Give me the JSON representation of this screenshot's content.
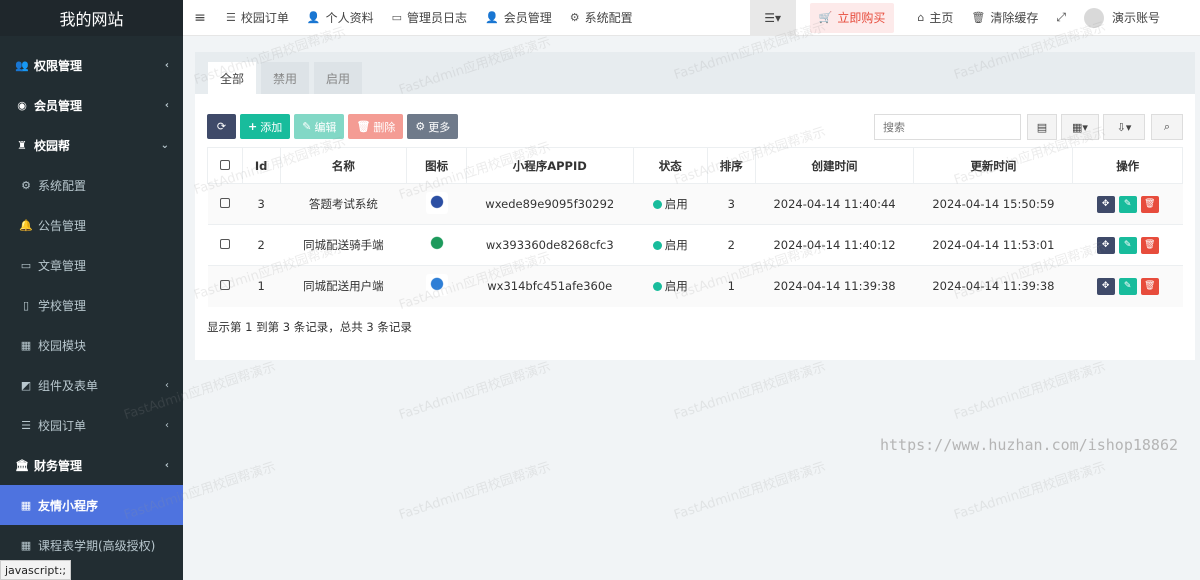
{
  "logo": "我的网站",
  "sidebar": {
    "items": [
      {
        "label": "权限管理",
        "icon": "users-icon",
        "top": true,
        "arrow": "‹"
      },
      {
        "label": "会员管理",
        "icon": "user-circle-icon",
        "top": true,
        "arrow": "‹"
      },
      {
        "label": "校园帮",
        "icon": "sitemap-icon",
        "top": true,
        "arrow": "⌄"
      },
      {
        "label": "系统配置",
        "icon": "cogs-icon",
        "top": false,
        "arrow": ""
      },
      {
        "label": "公告管理",
        "icon": "bell-icon",
        "top": false,
        "arrow": ""
      },
      {
        "label": "文章管理",
        "icon": "newspaper-icon",
        "top": false,
        "arrow": ""
      },
      {
        "label": "学校管理",
        "icon": "building-icon",
        "top": false,
        "arrow": ""
      },
      {
        "label": "校园模块",
        "icon": "grid-icon",
        "top": false,
        "arrow": ""
      },
      {
        "label": "组件及表单",
        "icon": "cubes-icon",
        "top": false,
        "arrow": "‹"
      },
      {
        "label": "校园订单",
        "icon": "list-icon",
        "top": false,
        "arrow": "‹"
      },
      {
        "label": "财务管理",
        "icon": "bank-icon",
        "top": true,
        "arrow": "‹"
      },
      {
        "label": "友情小程序",
        "icon": "grid-large-icon",
        "top": false,
        "arrow": "",
        "active": true
      },
      {
        "label": "课程表学期(高级授权)",
        "icon": "calendar-icon",
        "top": false,
        "arrow": ""
      }
    ]
  },
  "header": {
    "nav": [
      {
        "label": "校园订单",
        "icon": "list-icon"
      },
      {
        "label": "个人资料",
        "icon": "user-icon"
      },
      {
        "label": "管理员日志",
        "icon": "newspaper-icon"
      },
      {
        "label": "会员管理",
        "icon": "user-icon"
      },
      {
        "label": "系统配置",
        "icon": "cogs-icon"
      }
    ],
    "buy": "立即购买",
    "home": "主页",
    "clear_cache": "清除缓存",
    "account": "演示账号"
  },
  "tabs": [
    "全部",
    "禁用",
    "启用"
  ],
  "toolbar": {
    "add": "添加",
    "edit": "编辑",
    "delete": "删除",
    "more": "更多"
  },
  "search": {
    "placeholder": "搜索"
  },
  "table": {
    "headers": [
      "Id",
      "名称",
      "图标",
      "小程序APPID",
      "状态",
      "排序",
      "创建时间",
      "更新时间",
      "操作"
    ],
    "rows": [
      {
        "id": "3",
        "name": "答题考试系统",
        "appid": "wxede89e9095f30292",
        "status": "启用",
        "sort": "3",
        "created": "2024-04-14 11:40:44",
        "updated": "2024-04-14 15:50:59",
        "icon_color": "#2c4fa3"
      },
      {
        "id": "2",
        "name": "同城配送骑手端",
        "appid": "wx393360de8268cfc3",
        "status": "启用",
        "sort": "2",
        "created": "2024-04-14 11:40:12",
        "updated": "2024-04-14 11:53:01",
        "icon_color": "#1d9a5c"
      },
      {
        "id": "1",
        "name": "同城配送用户端",
        "appid": "wx314bfc451afe360e",
        "status": "启用",
        "sort": "1",
        "created": "2024-04-14 11:39:38",
        "updated": "2024-04-14 11:39:38",
        "icon_color": "#2f7fd6"
      }
    ]
  },
  "pager": "显示第 1 到第 3 条记录，总共 3 条记录",
  "watermark": "https://www.huzhan.com/ishop18862",
  "statusbar": "javascript:;",
  "wm_text": "FastAdmin应用校园帮演示"
}
